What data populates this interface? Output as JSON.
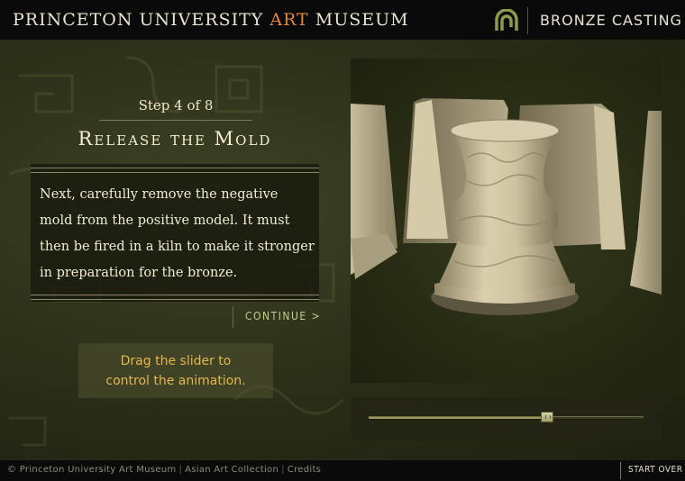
{
  "header": {
    "brand_part1": "PRINCETON UNIVERSITY ",
    "brand_accent": "ART",
    "brand_part2": " MUSEUM",
    "section_title": "BRONZE CASTING",
    "accent_color": "#e0853a"
  },
  "step": {
    "label": "Step 4 of 8",
    "title": "Release the Mold",
    "body": "Next, carefully remove the negative mold from the positive model. It must then be fired in a kiln to make it stronger in preparation for the bronze.",
    "continue_label": "CONTINUE >"
  },
  "hint": {
    "line1": "Drag the slider to",
    "line2": "control the animation."
  },
  "animation": {
    "slider_value": 0.65
  },
  "footer": {
    "copyright": "© Princeton University Art Museum",
    "collection_link": "Asian Art Collection",
    "credits_link": "Credits",
    "start_over": "START OVER"
  },
  "icons": {
    "logo": "spiral-logo-icon",
    "slider_grip": "grip-icon"
  }
}
